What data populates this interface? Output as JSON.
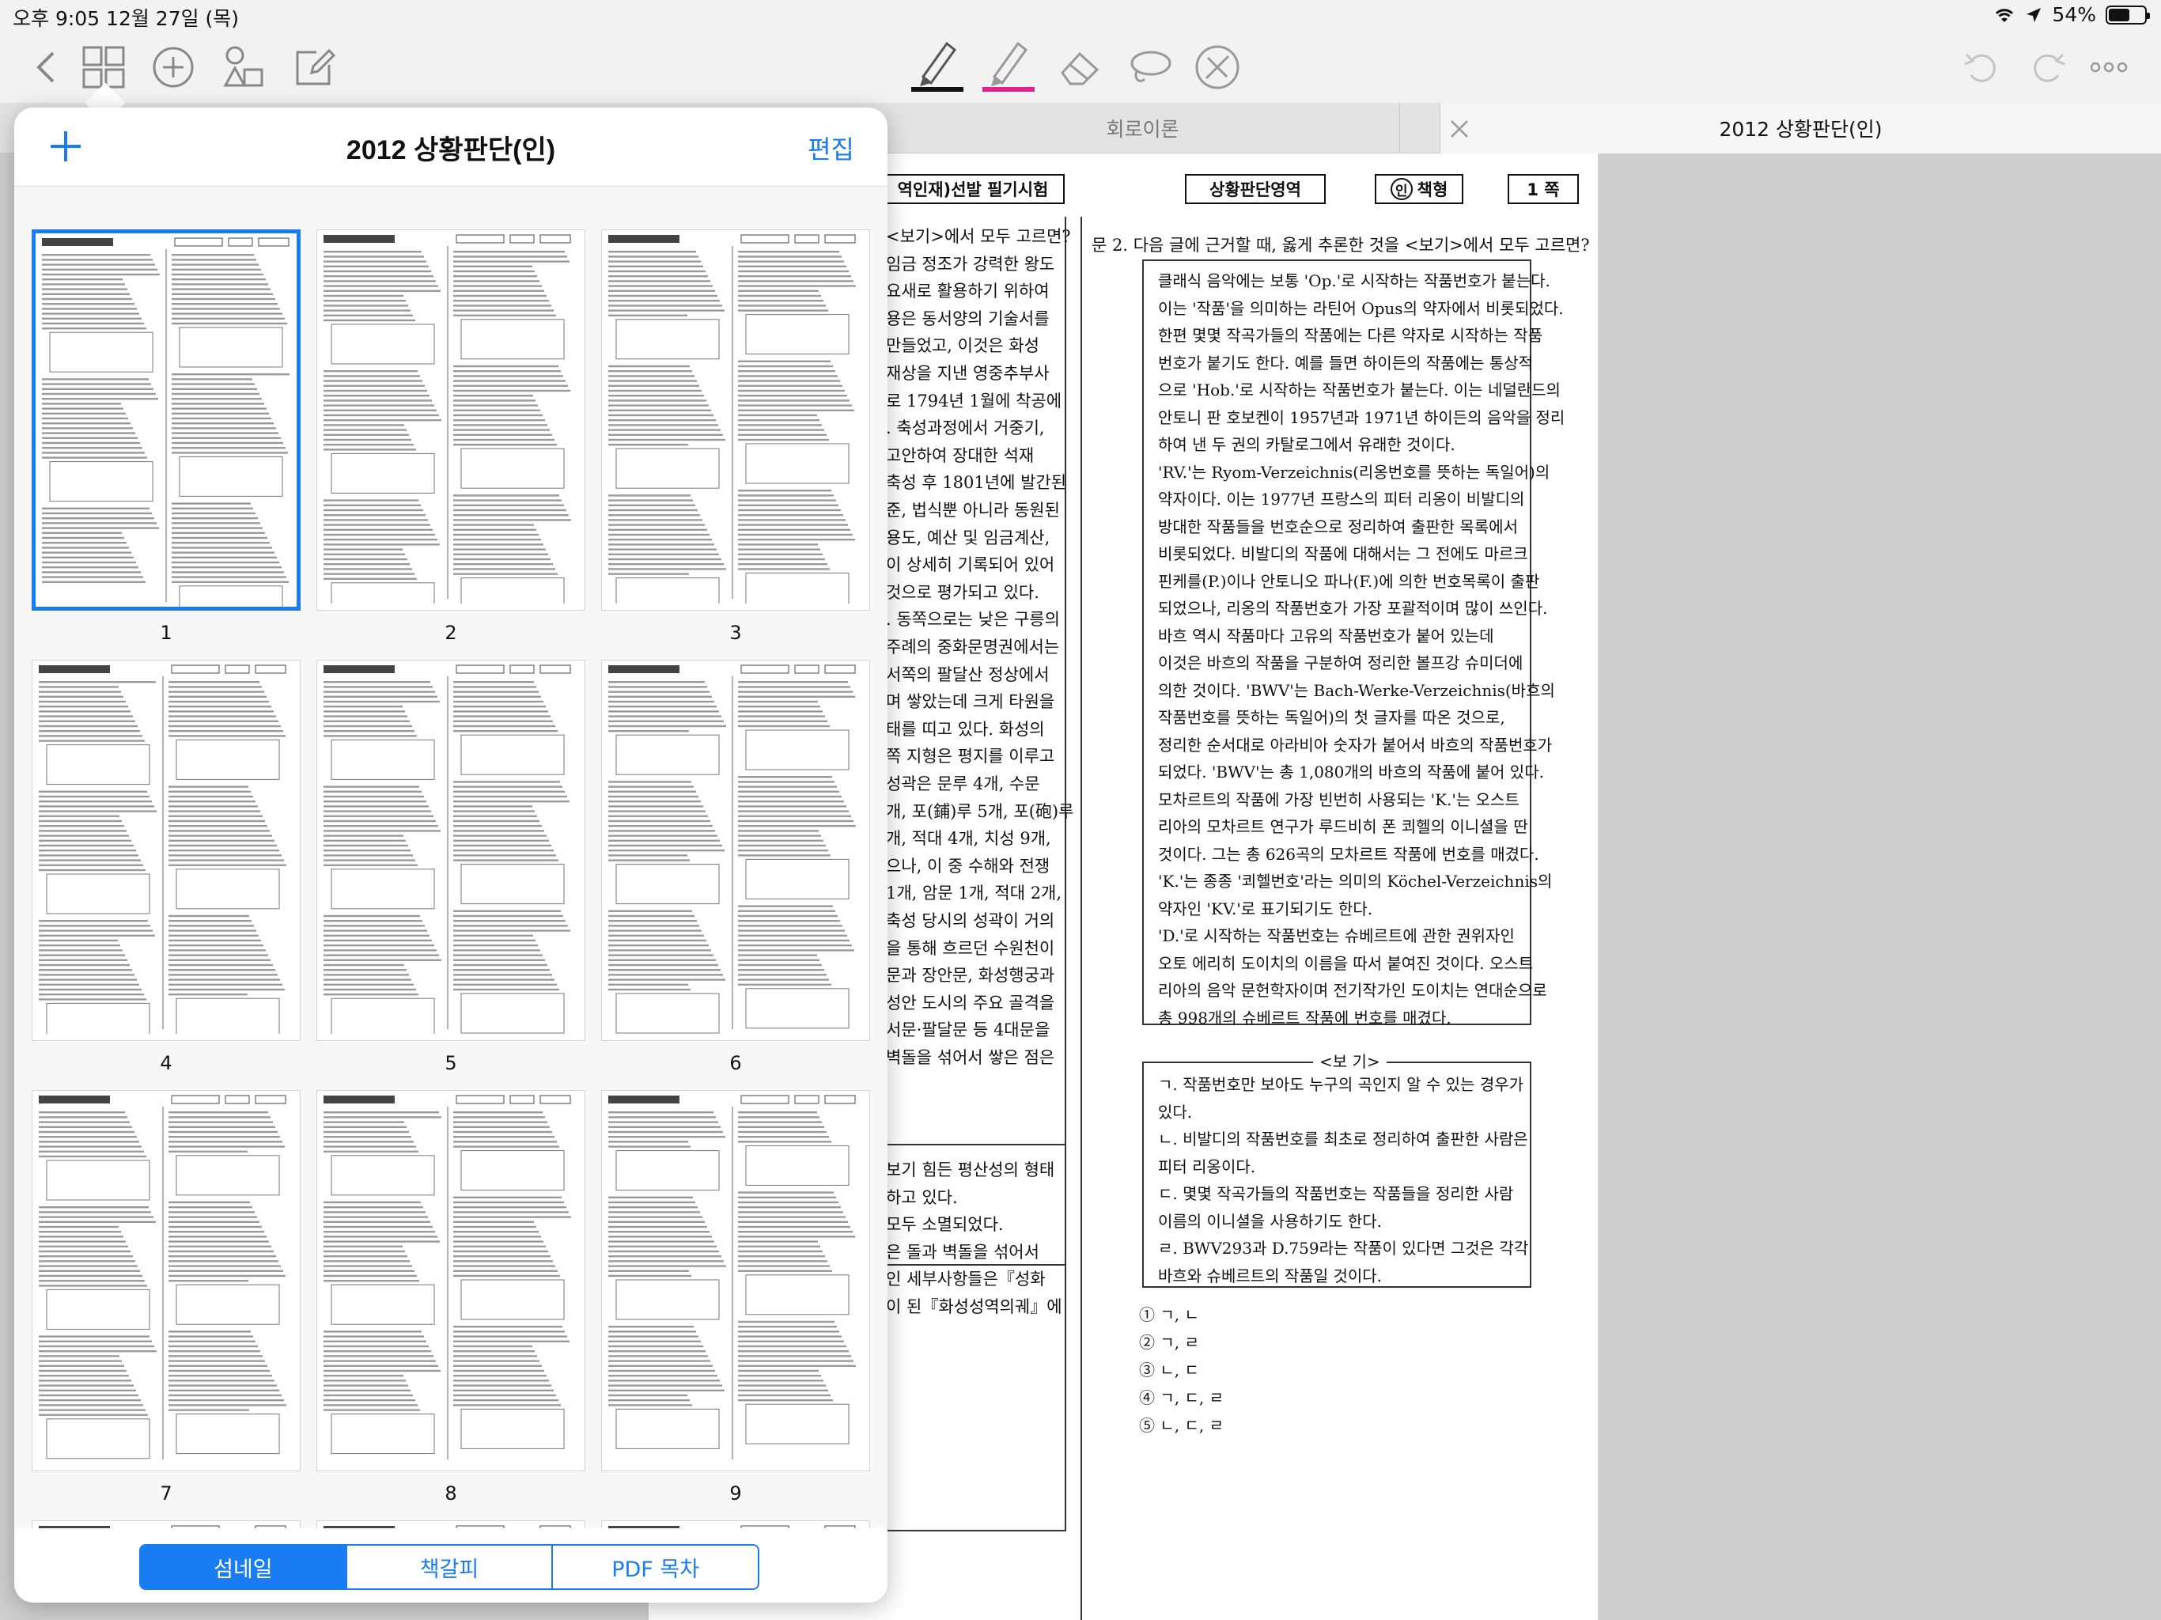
{
  "status_bar": {
    "time_date": "오후 9:05   12월 27일 (목)",
    "battery": "54%"
  },
  "toolbar": {
    "pen_colors": {
      "pen": "#111111",
      "highlighter": "#e0238f"
    }
  },
  "tabs": [
    {
      "label": "회로이론"
    },
    {
      "label": "2012 상황판단(인)"
    }
  ],
  "popover": {
    "title": "2012 상황판단(인)",
    "edit_label": "편집",
    "segments": [
      {
        "label": "섬네일"
      },
      {
        "label": "책갈피"
      },
      {
        "label": "PDF 목차"
      }
    ],
    "thumbnails": [
      {
        "page": "1"
      },
      {
        "page": "2"
      },
      {
        "page": "3"
      },
      {
        "page": "4"
      },
      {
        "page": "5"
      },
      {
        "page": "6"
      },
      {
        "page": "7"
      },
      {
        "page": "8"
      },
      {
        "page": "9"
      }
    ]
  },
  "document": {
    "header": {
      "exam": "역인재)선발 필기시험",
      "section": "상황판단영역",
      "booklet": "책형",
      "booklet_mark": "인",
      "page": "1 쪽"
    },
    "left_col_lines": [
      "<보기>에서 모두 고르면?",
      "임금 정조가 강력한 왕도",
      "요새로 활용하기 위하여",
      "용은 동서양의 기술서를",
      "만들었고, 이것은 화성",
      "재상을 지낸 영중추부사",
      "로 1794년 1월에 착공에",
      ". 축성과정에서 거중기,",
      "고안하여 장대한 석재",
      "축성 후 1801년에 발간된",
      "준, 법식뿐 아니라 동원된",
      "용도, 예산 및 임금계산,",
      "이 상세히 기록되어 있어",
      "것으로 평가되고 있다.",
      ". 동쪽으로는 낮은 구릉의",
      "주례의 중화문명권에서는",
      "서쪽의 팔달산 정상에서",
      "며 쌓았는데 크게 타원을",
      "태를 띠고 있다. 화성의",
      "쪽 지형은 평지를 이루고",
      "성곽은 문루 4개, 수문",
      "개, 포(鋪)루 5개, 포(砲)루",
      "개, 적대 4개, 치성 9개,",
      "으나, 이 중 수해와 전쟁",
      "1개, 암문 1개, 적대 2개,",
      "축성 당시의 성곽이 거의",
      "을 통해 흐르던 수원천이",
      "문과 장안문, 화성행궁과",
      "성안 도시의 주요 골격을",
      "서문·팔달문 등 4대문을",
      "벽돌을 섞어서 쌓은 점은"
    ],
    "left_col_lines_2": [
      "보기 힘든 평산성의 형태",
      "하고 있다.",
      "모두 소멸되었다.",
      "은 돌과 벽돌을 섞어서",
      "인 세부사항들은『성화",
      "이 된『화성성역의궤』에"
    ],
    "question": "문  2. 다음 글에 근거할 때, 옳게 추론한 것을 <보기>에서 모두 고르면?",
    "passage_lines": [
      "클래식 음악에는 보통 'Op.'로 시작하는 작품번호가 붙는다.",
      "이는 '작품'을 의미하는 라틴어 Opus의 약자에서 비롯되었다.",
      "한편 몇몇 작곡가들의 작품에는 다른 약자로 시작하는 작품",
      "번호가 붙기도 한다. 예를 들면 하이든의 작품에는 통상적",
      "으로 'Hob.'로 시작하는 작품번호가 붙는다. 이는 네덜란드의",
      "안토니 판 호보켄이 1957년과 1971년 하이든의 음악을 정리",
      "하여 낸 두 권의 카탈로그에서 유래한 것이다.",
      "'RV.'는 Ryom-Verzeichnis(리옹번호를 뜻하는 독일어)의",
      "약자이다. 이는 1977년 프랑스의 피터 리옹이 비발디의",
      "방대한 작품들을 번호순으로 정리하여 출판한 목록에서",
      "비롯되었다. 비발디의 작품에 대해서는 그 전에도 마르크",
      "핀케를(P.)이나 안토니오 파나(F.)에 의한 번호목록이 출판",
      "되었으나, 리옹의 작품번호가 가장 포괄적이며 많이 쓰인다.",
      "바흐 역시 작품마다 고유의 작품번호가 붙어 있는데",
      "이것은 바흐의 작품을 구분하여 정리한 볼프강 슈미더에",
      "의한 것이다. 'BWV'는 Bach-Werke-Verzeichnis(바흐의",
      "작품번호를 뜻하는 독일어)의 첫 글자를 따온 것으로,",
      "정리한 순서대로 아라비아 숫자가 붙어서 바흐의 작품번호가",
      "되었다. 'BWV'는 총 1,080개의 바흐의 작품에 붙어 있다.",
      "모차르트의 작품에 가장 빈번히 사용되는 'K.'는 오스트",
      "리아의 모차르트 연구가 루드비히 폰 쾨헬의 이니셜을 딴",
      "것이다. 그는 총 626곡의 모차르트 작품에 번호를 매겼다.",
      "'K.'는 종종 '쾨헬번호'라는 의미의 Köchel-Verzeichnis의",
      "약자인 'KV.'로 표기되기도 한다.",
      "'D.'로 시작하는 작품번호는 슈베르트에 관한 권위자인",
      "오토 에리히 도이치의 이름을 따서 붙여진 것이다. 오스트",
      "리아의 음악 문헌학자이며 전기작가인 도이치는 연대순으로",
      "총 998개의 슈베르트 작품에 번호를 매겼다."
    ],
    "bogi_title": "<보  기>",
    "bogi_lines": [
      "ㄱ. 작품번호만 보아도 누구의 곡인지 알 수 있는 경우가",
      "    있다.",
      "ㄴ. 비발디의 작품번호를 최초로 정리하여 출판한 사람은",
      "    피터 리옹이다.",
      "ㄷ. 몇몇 작곡가들의 작품번호는 작품들을 정리한 사람",
      "    이름의 이니셜을 사용하기도 한다.",
      "ㄹ. BWV293과 D.759라는 작품이 있다면 그것은 각각",
      "    바흐와 슈베르트의 작품일 것이다."
    ],
    "choices": [
      "① ㄱ, ㄴ",
      "② ㄱ, ㄹ",
      "③ ㄴ, ㄷ",
      "④ ㄱ, ㄷ, ㄹ",
      "⑤ ㄴ, ㄷ, ㄹ"
    ]
  }
}
